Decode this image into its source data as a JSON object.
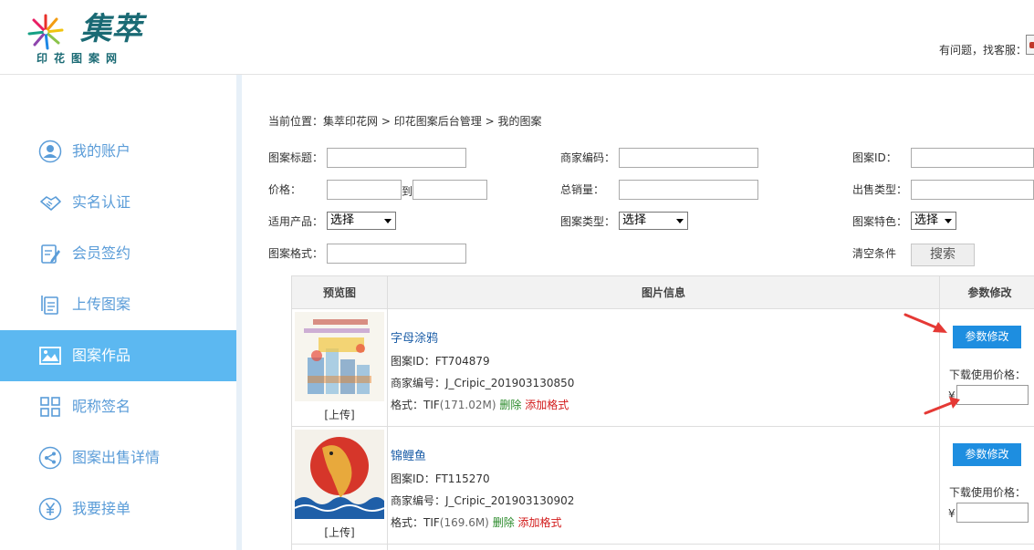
{
  "header": {
    "logo_text": "集萃",
    "logo_sub": "印花图案网",
    "help_text": "有问题，找客服："
  },
  "sidebar": {
    "items": [
      {
        "label": "我的账户",
        "icon": "user-icon"
      },
      {
        "label": "实名认证",
        "icon": "handshake-icon"
      },
      {
        "label": "会员签约",
        "icon": "contract-icon"
      },
      {
        "label": "上传图案",
        "icon": "document-icon"
      },
      {
        "label": "图案作品",
        "icon": "image-icon"
      },
      {
        "label": "昵称签名",
        "icon": "grid-icon"
      },
      {
        "label": "图案出售详情",
        "icon": "share-icon"
      },
      {
        "label": "我要接单",
        "icon": "yen-icon"
      }
    ],
    "active_index": 4
  },
  "breadcrumb": {
    "prefix": "当前位置：",
    "items": [
      "集萃印花网",
      "印花图案后台管理",
      "我的图案"
    ],
    "separator": ">"
  },
  "filters": {
    "title_label": "图案标题：",
    "merchant_code_label": "商家编码：",
    "pattern_id_label": "图案ID：",
    "price_label": "价格：",
    "price_to": "到",
    "total_sales_label": "总销量：",
    "sale_type_label": "出售类型：",
    "product_label": "适用产品：",
    "product_value": "选择",
    "pattern_type_label": "图案类型：",
    "pattern_type_value": "选择",
    "pattern_feature_label": "图案特色：",
    "pattern_feature_value": "选择",
    "format_label": "图案格式：",
    "clear_label": "清空条件",
    "search_label": "搜索"
  },
  "table": {
    "headers": [
      "预览图",
      "图片信息",
      "参数修改"
    ],
    "rows": [
      {
        "title": "字母涂鸦",
        "id_label": "图案ID：",
        "id": "FT704879",
        "merchant_label": "商家编号：",
        "merchant": "J_Cripic_201903130850",
        "format_label": "格式：",
        "format": "TIF",
        "format_size": "(171.02M)",
        "delete": "删除",
        "add_format": "添加格式",
        "upload": "[上传]",
        "param_button": "参数修改",
        "download_price_label": "下载使用价格：",
        "currency": "¥"
      },
      {
        "title": "锦鲤鱼",
        "id_label": "图案ID：",
        "id": "FT115270",
        "merchant_label": "商家编号：",
        "merchant": "J_Cripic_201903130902",
        "format_label": "格式：",
        "format": "TIF",
        "format_size": "(169.6M)",
        "delete": "删除",
        "add_format": "添加格式",
        "upload": "[上传]",
        "param_button": "参数修改",
        "download_price_label": "下载使用价格：",
        "currency": "¥"
      }
    ]
  },
  "colors": {
    "sidebar_active": "#5cb8f1",
    "sidebar_text": "#5a9cd8",
    "button_blue": "#1e8ee0",
    "link_blue": "#1e5fa8",
    "delete_green": "#2a8a2a",
    "add_red": "#d21a1a"
  }
}
